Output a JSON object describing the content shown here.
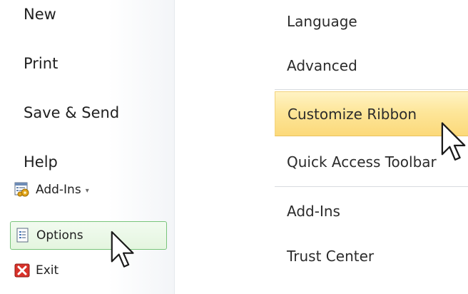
{
  "backstage": {
    "items": [
      {
        "label": "New"
      },
      {
        "label": "Print"
      },
      {
        "label": "Save & Send"
      },
      {
        "label": "Help"
      }
    ],
    "addins_label": "Add-Ins",
    "options_label": "Options",
    "exit_label": "Exit"
  },
  "options": {
    "categories": [
      {
        "label": "Language"
      },
      {
        "label": "Advanced"
      },
      {
        "label": "Customize Ribbon",
        "selected": true
      },
      {
        "label": "Quick Access Toolbar"
      },
      {
        "label": "Add-Ins"
      },
      {
        "label": "Trust Center"
      }
    ]
  },
  "colors": {
    "selected_highlight": "#fde69a",
    "options_hover_border": "#78c47a",
    "exit_icon": "#d8322a"
  },
  "icons": {
    "addins": "addins-gear-icon",
    "options": "options-document-icon",
    "exit": "exit-x-icon",
    "caret": "chevron-down-icon",
    "cursor": "mouse-pointer-icon"
  }
}
